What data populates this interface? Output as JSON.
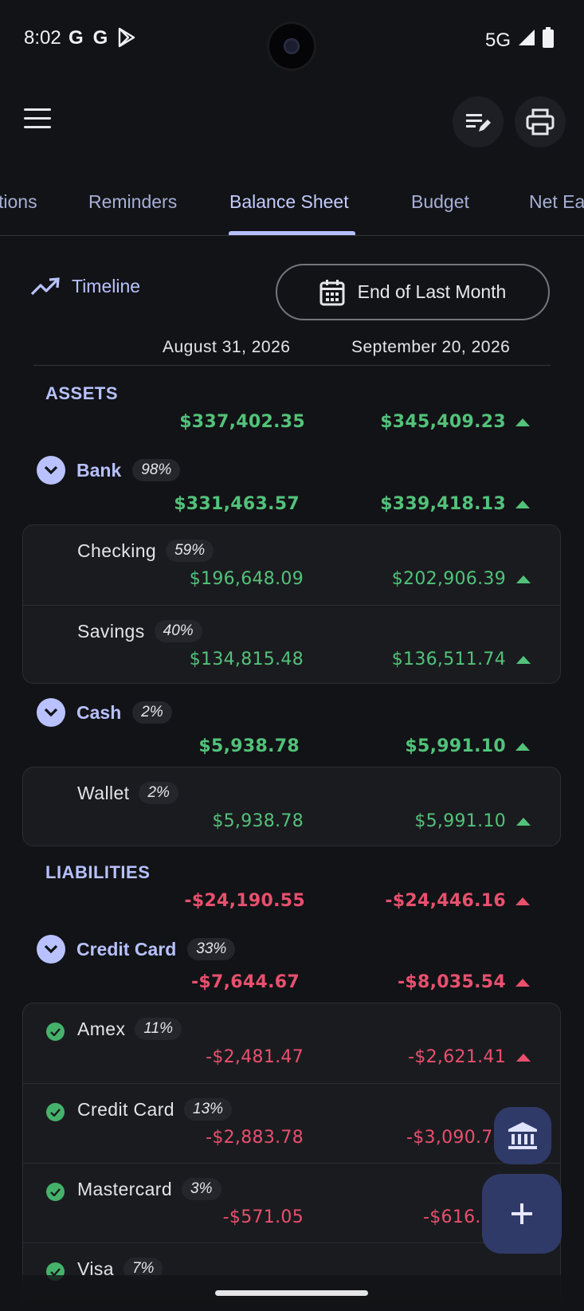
{
  "status": {
    "time": "8:02",
    "left_icons": [
      "G",
      "G"
    ],
    "network": "5G"
  },
  "tabs": [
    {
      "label": "tions"
    },
    {
      "label": "Reminders"
    },
    {
      "label": "Balance Sheet"
    },
    {
      "label": "Budget"
    },
    {
      "label": "Net Ea"
    }
  ],
  "controls": {
    "timeline_label": "Timeline",
    "period_label": "End of Last Month"
  },
  "columns": {
    "left": "August 31, 2026",
    "right": "September 20, 2026"
  },
  "assets": {
    "label": "ASSETS",
    "left": "$337,402.35",
    "right": "$345,409.23",
    "groups": [
      {
        "name": "Bank",
        "pct": "98%",
        "left": "$331,463.57",
        "right": "$339,418.13",
        "accounts": [
          {
            "name": "Checking",
            "pct": "59%",
            "left": "$196,648.09",
            "right": "$202,906.39"
          },
          {
            "name": "Savings",
            "pct": "40%",
            "left": "$134,815.48",
            "right": "$136,511.74"
          }
        ]
      },
      {
        "name": "Cash",
        "pct": "2%",
        "left": "$5,938.78",
        "right": "$5,991.10",
        "accounts": [
          {
            "name": "Wallet",
            "pct": "2%",
            "left": "$5,938.78",
            "right": "$5,991.10"
          }
        ]
      }
    ]
  },
  "liabilities": {
    "label": "LIABILITIES",
    "left": "-$24,190.55",
    "right": "-$24,446.16",
    "groups": [
      {
        "name": "Credit Card",
        "pct": "33%",
        "left": "-$7,644.67",
        "right": "-$8,035.54",
        "accounts": [
          {
            "name": "Amex",
            "pct": "11%",
            "left": "-$2,481.47",
            "right": "-$2,621.41"
          },
          {
            "name": "Credit Card",
            "pct": "13%",
            "left": "-$2,883.78",
            "right": "-$3,090.7"
          },
          {
            "name": "Mastercard",
            "pct": "3%",
            "left": "-$571.05",
            "right": "-$616."
          },
          {
            "name": "Visa",
            "pct": "7%",
            "left": "",
            "right": ""
          }
        ]
      }
    ]
  },
  "colors": {
    "background": "#121316",
    "accent": "#b7c1ff",
    "positive": "#52c27a",
    "negative": "#e8506e",
    "fab": "#2f3a68"
  }
}
